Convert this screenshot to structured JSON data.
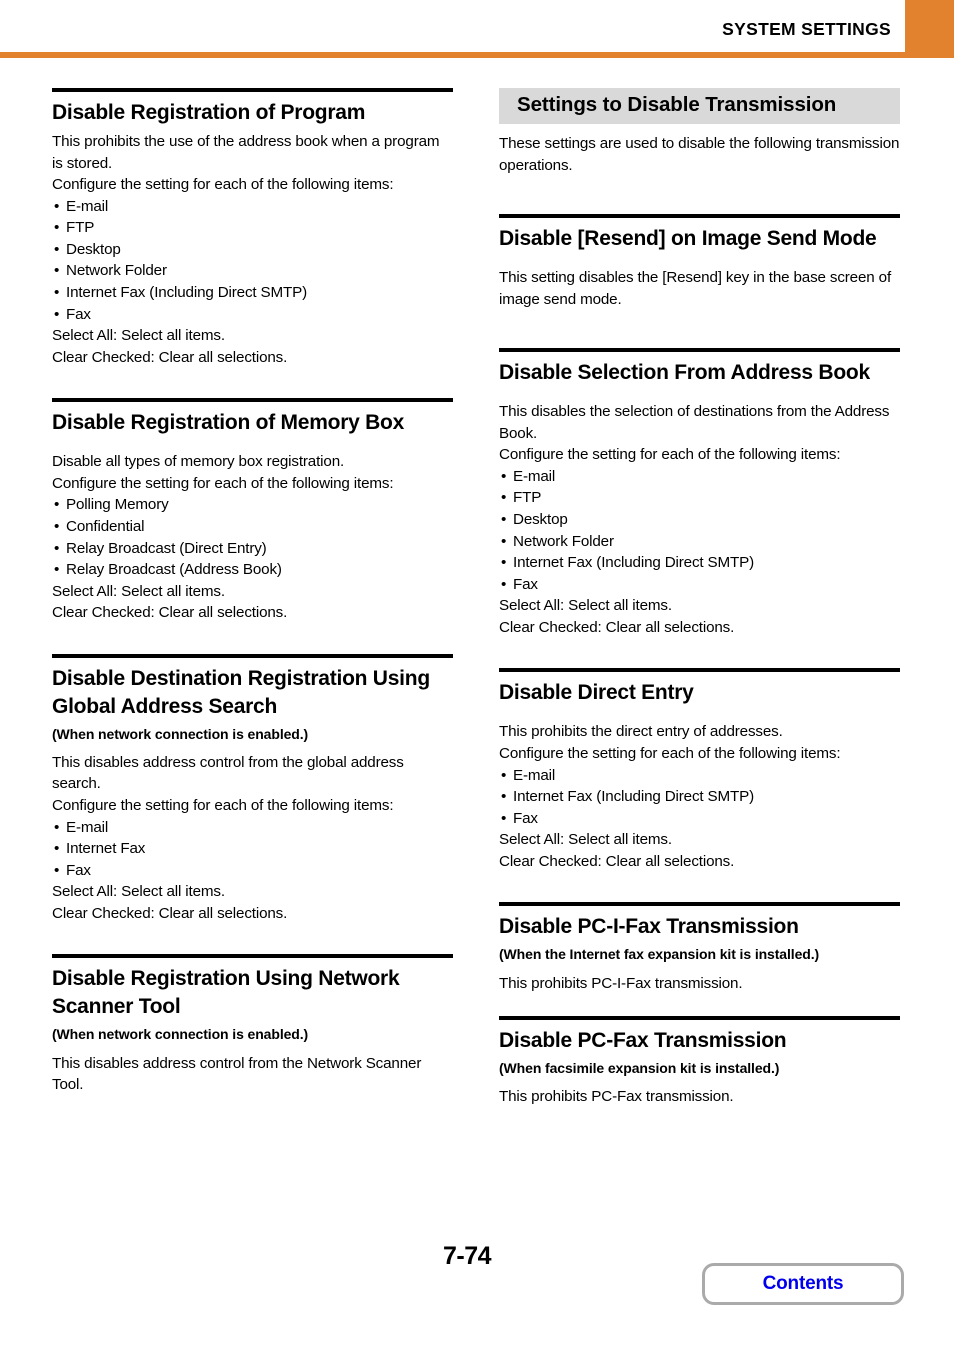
{
  "header": {
    "title": "SYSTEM SETTINGS",
    "accent_color": "#E2822F"
  },
  "banner_color": "#D9D9D9",
  "left_column": [
    {
      "title": "Disable Registration of Program",
      "paragraphs": [
        "This prohibits the use of the address book when a program is stored.",
        "Configure the setting for each of the following items:"
      ],
      "bullets": [
        "E-mail",
        "FTP",
        "Desktop",
        "Network Folder",
        "Internet Fax (Including Direct SMTP)",
        "Fax"
      ],
      "footers": [
        "Select All: Select all items.",
        "Clear Checked: Clear all selections."
      ]
    },
    {
      "title": "Disable Registration of Memory Box",
      "paragraphs": [
        "Disable all types of memory box registration.",
        "Configure the setting for each of the following items:"
      ],
      "bullets": [
        "Polling Memory",
        "Confidential",
        "Relay Broadcast (Direct Entry)",
        "Relay Broadcast (Address Book)"
      ],
      "footers": [
        "Select All: Select all items.",
        "Clear Checked: Clear all selections."
      ]
    },
    {
      "title": "Disable Destination Registration Using Global Address Search",
      "subtitle": "(When network connection is enabled.)",
      "paragraphs": [
        "This disables address control from the global address search.",
        "Configure the setting for each of the following items:"
      ],
      "bullets": [
        "E-mail",
        "Internet Fax",
        "Fax"
      ],
      "footers": [
        "Select All: Select all items.",
        "Clear Checked: Clear all selections."
      ]
    },
    {
      "title": "Disable Registration Using Network Scanner Tool",
      "subtitle": "(When network connection is enabled.)",
      "paragraphs": [
        "This disables address control from the Network Scanner Tool."
      ],
      "bullets": [],
      "footers": []
    }
  ],
  "right_column": {
    "banner": {
      "title": "Settings to Disable Transmission",
      "intro": "These settings are used to disable the following transmission operations."
    },
    "sections": [
      {
        "title": "Disable [Resend] on Image Send Mode",
        "paragraphs": [
          "This setting disables the [Resend] key in the base screen of image send mode."
        ],
        "bullets": [],
        "footers": []
      },
      {
        "title": "Disable Selection From Address Book",
        "paragraphs": [
          "This disables the selection of destinations from the Address Book.",
          "Configure the setting for each of the following items:"
        ],
        "bullets": [
          "E-mail",
          "FTP",
          "Desktop",
          "Network Folder",
          "Internet Fax (Including Direct SMTP)",
          "Fax"
        ],
        "footers": [
          "Select All: Select all items.",
          "Clear Checked: Clear all selections."
        ]
      },
      {
        "title": "Disable Direct Entry",
        "paragraphs": [
          "This prohibits the direct entry of addresses.",
          "Configure the setting for each of the following items:"
        ],
        "bullets": [
          "E-mail",
          "Internet Fax (Including Direct SMTP)",
          "Fax"
        ],
        "footers": [
          "Select All: Select all items.",
          "Clear Checked: Clear all selections."
        ]
      },
      {
        "title": "Disable PC-I-Fax Transmission",
        "subtitle": "(When the Internet fax expansion kit is installed.)",
        "paragraphs": [
          "This prohibits PC-I-Fax transmission."
        ],
        "bullets": [],
        "footers": []
      },
      {
        "title": "Disable PC-Fax Transmission",
        "subtitle": "(When facsimile expansion kit is installed.)",
        "paragraphs": [
          "This prohibits PC-Fax transmission."
        ],
        "bullets": [],
        "footers": []
      }
    ]
  },
  "footer": {
    "page_number": "7-74",
    "contents_label": "Contents",
    "contents_link_color": "#0000EE"
  }
}
